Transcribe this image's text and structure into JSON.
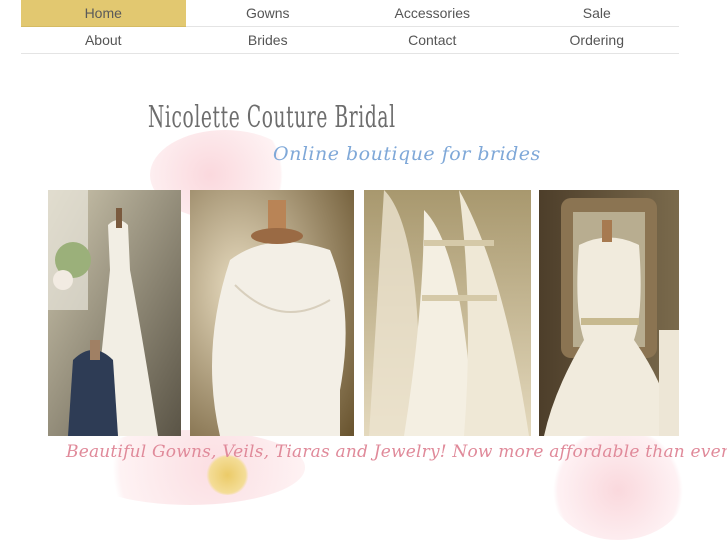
{
  "nav": {
    "row1": [
      {
        "label": "Home",
        "active": true
      },
      {
        "label": "Gowns",
        "active": false
      },
      {
        "label": "Accessories",
        "active": false
      },
      {
        "label": "Sale",
        "active": false
      }
    ],
    "row2": [
      {
        "label": "About",
        "active": false
      },
      {
        "label": "Brides",
        "active": false
      },
      {
        "label": "Contact",
        "active": false
      },
      {
        "label": "Ordering",
        "active": false
      }
    ],
    "accent_color": "#e2c870"
  },
  "header": {
    "brand": "Nicolette Couture Bridal",
    "tagline": "Online boutique for brides"
  },
  "photos": [
    {
      "name": "gown-photo-1"
    },
    {
      "name": "gown-photo-2"
    },
    {
      "name": "gown-photo-3"
    },
    {
      "name": "gown-photo-4"
    }
  ],
  "slogan": "Beautiful Gowns, Veils, Tiaras and Jewelry! Now more affordable than ever!"
}
